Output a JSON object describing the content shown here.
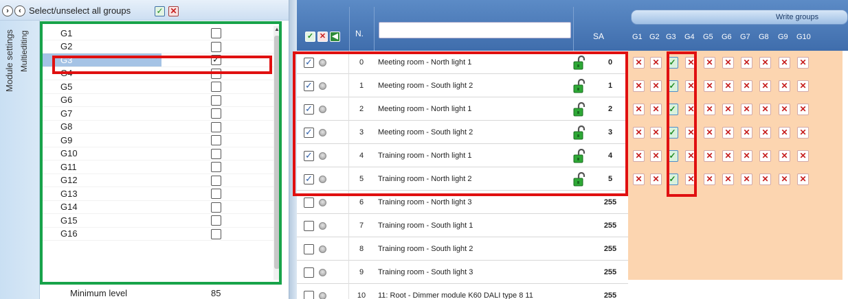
{
  "left_panel": {
    "vertical_tabs": [
      "Module settings",
      "Multiediting"
    ],
    "select_all_label": "Select/unselect all groups",
    "groups": [
      {
        "name": "G1",
        "checked": false
      },
      {
        "name": "G2",
        "checked": false
      },
      {
        "name": "G3",
        "checked": true,
        "selected": true
      },
      {
        "name": "G4",
        "checked": false
      },
      {
        "name": "G5",
        "checked": false
      },
      {
        "name": "G6",
        "checked": false
      },
      {
        "name": "G7",
        "checked": false
      },
      {
        "name": "G8",
        "checked": false
      },
      {
        "name": "G9",
        "checked": false
      },
      {
        "name": "G10",
        "checked": false
      },
      {
        "name": "G11",
        "checked": false
      },
      {
        "name": "G12",
        "checked": false
      },
      {
        "name": "G13",
        "checked": false
      },
      {
        "name": "G14",
        "checked": false
      },
      {
        "name": "G15",
        "checked": false
      },
      {
        "name": "G16",
        "checked": false
      }
    ],
    "minimum_level_label": "Minimum level",
    "minimum_level_value": "85"
  },
  "device_table": {
    "header": {
      "n_label": "N.",
      "sa_label": "SA",
      "filter_value": ""
    },
    "rows": [
      {
        "checked": true,
        "n": "0",
        "name": "Meeting room - North light 1",
        "locked": true,
        "sa": "0"
      },
      {
        "checked": true,
        "n": "1",
        "name": "Meeting room - South light  2",
        "locked": true,
        "sa": "1"
      },
      {
        "checked": true,
        "n": "2",
        "name": "Meeting room - North light  1",
        "locked": true,
        "sa": "2"
      },
      {
        "checked": true,
        "n": "3",
        "name": "Meeting room - South light  2",
        "locked": true,
        "sa": "3"
      },
      {
        "checked": true,
        "n": "4",
        "name": "Training room - North light 1",
        "locked": true,
        "sa": "4"
      },
      {
        "checked": true,
        "n": "5",
        "name": "Training room - North light 2",
        "locked": true,
        "sa": "5"
      },
      {
        "checked": false,
        "n": "6",
        "name": "Training room - North light 3",
        "locked": false,
        "sa": "255"
      },
      {
        "checked": false,
        "n": "7",
        "name": "Training room - South light 1",
        "locked": false,
        "sa": "255"
      },
      {
        "checked": false,
        "n": "8",
        "name": "Training room - South light 2",
        "locked": false,
        "sa": "255"
      },
      {
        "checked": false,
        "n": "9",
        "name": "Training room - South light 3",
        "locked": false,
        "sa": "255"
      },
      {
        "checked": false,
        "n": "10",
        "name": "11: Root - Dimmer module K60  DALI type 8 11",
        "locked": false,
        "sa": "255"
      }
    ]
  },
  "write_groups": {
    "title": "Write groups",
    "columns": [
      "G1",
      "G2",
      "G3",
      "G4",
      "G5",
      "G6",
      "G7",
      "G8",
      "G9",
      "G10"
    ],
    "rows": [
      [
        false,
        false,
        true,
        false,
        false,
        false,
        false,
        false,
        false,
        false
      ],
      [
        false,
        false,
        true,
        false,
        false,
        false,
        false,
        false,
        false,
        false
      ],
      [
        false,
        false,
        true,
        false,
        false,
        false,
        false,
        false,
        false,
        false
      ],
      [
        false,
        false,
        true,
        false,
        false,
        false,
        false,
        false,
        false,
        false
      ],
      [
        false,
        false,
        true,
        false,
        false,
        false,
        false,
        false,
        false,
        false
      ],
      [
        false,
        false,
        true,
        false,
        false,
        false,
        false,
        false,
        false,
        false
      ]
    ]
  },
  "colors": {
    "highlight_red": "#e01010",
    "highlight_green": "#18a34a",
    "header_blue": "#4a78b8",
    "write_groups_bg": "#fcd5b0",
    "selected_row": "#a5c3e5"
  },
  "icons": {
    "expand": "chevron-right-icon",
    "collapse": "chevron-left-icon",
    "check_all": "check-icon",
    "uncheck_all": "x-icon",
    "lock": "unlocked-padlock-icon",
    "status": "gray-led-icon"
  }
}
